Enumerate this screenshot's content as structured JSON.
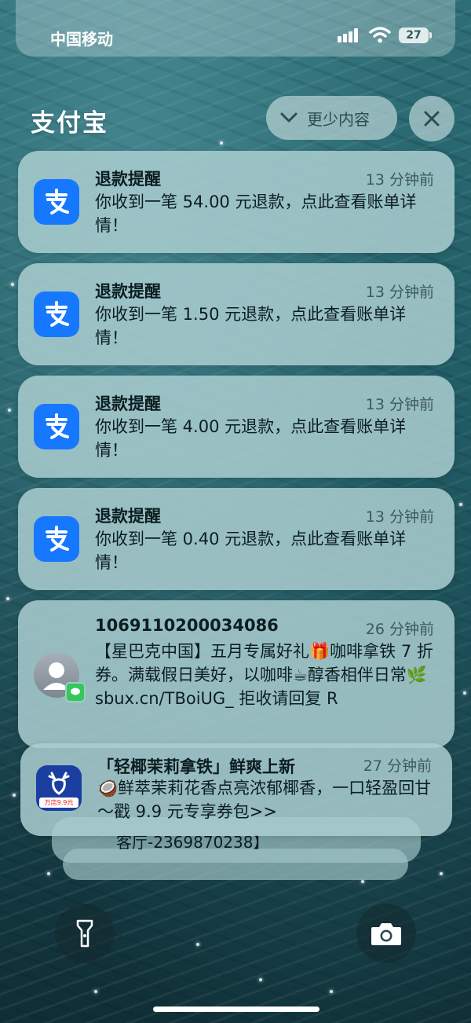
{
  "status_bar": {
    "carrier": "中国移动",
    "battery": "27",
    "signal_icon": "cellular-signal-icon",
    "wifi_icon": "wifi-icon"
  },
  "group": {
    "app_name": "支付宝",
    "show_less_label": "更少内容",
    "show_less_icon": "chevron-down-icon",
    "close_icon": "close-icon"
  },
  "notifications": [
    {
      "app": "alipay",
      "title": "退款提醒",
      "time": "13 分钟前",
      "body": "你收到一笔 54.00 元退款，点此查看账单详情！"
    },
    {
      "app": "alipay",
      "title": "退款提醒",
      "time": "13 分钟前",
      "body": "你收到一笔 1.50 元退款，点此查看账单详情！"
    },
    {
      "app": "alipay",
      "title": "退款提醒",
      "time": "13 分钟前",
      "body": "你收到一笔 4.00 元退款，点此查看账单详情！"
    },
    {
      "app": "alipay",
      "title": "退款提醒",
      "time": "13 分钟前",
      "body": "你收到一笔 0.40 元退款，点此查看账单详情！"
    },
    {
      "app": "messages",
      "title": "106911020003408​6",
      "time": "26 分钟前",
      "body": "【星巴克中国】五月专属好礼🎁咖啡拿铁 7 折券。满载假日美好，以咖啡☕醇香相伴日常🌿 sbux.cn/TBoiUG_ 拒收请回复 R"
    },
    {
      "app": "luckin",
      "title": "「轻椰茉莉拿铁」鲜爽上新",
      "time": "27 分钟前",
      "body": "🥥鲜萃茉莉花香点亮浓郁椰香，一口轻盈回甘～戳 9.9 元专享券包>>",
      "icon_badge": "万店9.9元"
    }
  ],
  "stacked_preview_text": "客厅-2369870238】",
  "bottom": {
    "flashlight_icon": "flashlight-icon",
    "camera_icon": "camera-icon"
  },
  "colors": {
    "alipay_blue": "#1677ff",
    "messages_green": "#34c759",
    "luckin_blue": "#1a3fa0"
  }
}
